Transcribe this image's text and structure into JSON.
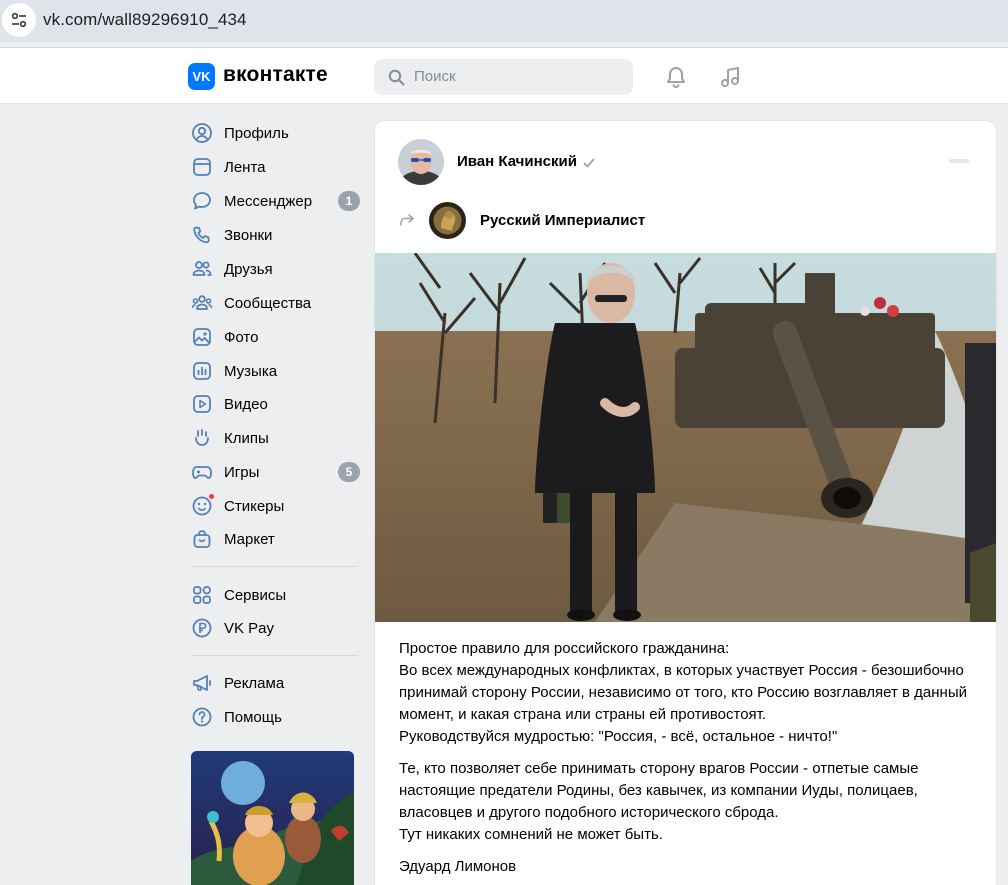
{
  "browser": {
    "url": "vk.com/wall89296910_434"
  },
  "header": {
    "logo_mark": "VK",
    "logo_text": "вконтакте",
    "search_placeholder": "Поиск"
  },
  "sidebar": {
    "items": [
      {
        "label": "Профиль",
        "icon": "user-circle-icon"
      },
      {
        "label": "Лента",
        "icon": "feed-icon"
      },
      {
        "label": "Мессенджер",
        "icon": "message-icon",
        "badge": "1"
      },
      {
        "label": "Звонки",
        "icon": "phone-icon"
      },
      {
        "label": "Друзья",
        "icon": "friends-icon"
      },
      {
        "label": "Сообщества",
        "icon": "communities-icon"
      },
      {
        "label": "Фото",
        "icon": "photo-icon"
      },
      {
        "label": "Музыка",
        "icon": "music-icon"
      },
      {
        "label": "Видео",
        "icon": "video-icon"
      },
      {
        "label": "Клипы",
        "icon": "clips-icon"
      },
      {
        "label": "Игры",
        "icon": "gamepad-icon",
        "badge": "5"
      },
      {
        "label": "Стикеры",
        "icon": "sticker-icon"
      },
      {
        "label": "Маркет",
        "icon": "market-icon"
      },
      {
        "label": "Сервисы",
        "icon": "services-icon"
      },
      {
        "label": "VK Pay",
        "icon": "vkpay-icon"
      },
      {
        "label": "Реклама",
        "icon": "megaphone-icon"
      },
      {
        "label": "Помощь",
        "icon": "help-icon"
      }
    ]
  },
  "post": {
    "author": "Иван Качинский",
    "group": "Русский Империалист",
    "paragraphs": [
      "Простое правило для российского гражданина:\nВо всех международных конфликтах, в которых участвует Россия - безошибочно принимай сторону России, независимо от того, кто Россию возглавляет в данный момент, и какая страна или страны ей противостоят.\nРуководствуйся мудростью: \"Россия, - всё, остальное - ничто!\"",
      "Те, кто позволяет себе принимать сторону врагов России - отпетые самые настоящие предатели Родины, без кавычек, из компании Иуды, полицаев, власовцев и другого подобного исторического сброда.\nТут никаких сомнений не может быть.",
      "Эдуард Лимонов"
    ]
  },
  "colors": {
    "accent": "#0077ff",
    "badge": "#99a2ad",
    "icon": "#5181b8"
  }
}
